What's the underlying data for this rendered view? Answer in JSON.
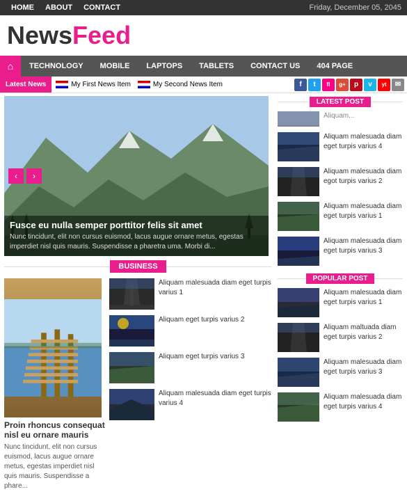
{
  "topbar": {
    "nav": [
      "HOME",
      "ABOUT",
      "CONTACT"
    ],
    "date": "Friday, December 05, 2045"
  },
  "logo": {
    "news": "News",
    "feed": "Feed"
  },
  "mainnav": {
    "home_icon": "⌂",
    "items": [
      "TECHNOLOGY",
      "MOBILE",
      "LAPTOPS",
      "TABLETS",
      "CONTACT US",
      "404 PAGE"
    ]
  },
  "ticker": {
    "label": "Latest News",
    "items": [
      {
        "text": "My First News Item"
      },
      {
        "text": "My Second News Item"
      }
    ]
  },
  "social_icons": [
    {
      "name": "facebook",
      "label": "f",
      "color": "#3b5998"
    },
    {
      "name": "twitter",
      "label": "t",
      "color": "#1da1f2"
    },
    {
      "name": "flickr",
      "label": "fl",
      "color": "#ff0084"
    },
    {
      "name": "googleplus",
      "label": "g+",
      "color": "#dd4b39"
    },
    {
      "name": "pinterest",
      "label": "p",
      "color": "#bd081c"
    },
    {
      "name": "vimeo",
      "label": "v",
      "color": "#1ab7ea"
    },
    {
      "name": "youtube",
      "label": "yt",
      "color": "#ff0000"
    },
    {
      "name": "email",
      "label": "✉",
      "color": "#888"
    }
  ],
  "slider": {
    "caption_title": "Fusce eu nulla semper porttitor felis sit amet",
    "caption_text": "Nunc tincidunt, elit non cursus euismod, lacus augue ornare metus, egestas imperdiet nisl quis mauris. Suspendisse a pharetra uma. Morbi di..."
  },
  "business": {
    "section_label": "BUSINESS",
    "main_title": "Proin rhoncus consequat nisl eu ornare mauris",
    "main_desc": "Nunc tincidunt, elit non cursus euismod, lacus augue ornare metus, egestas imperdiet nisl quis mauris. Suspendisse a phare...",
    "list": [
      {
        "text": "Aliquam malesuada diam eget turpis varius 1"
      },
      {
        "text": "Aliquam eget turpis varius 2"
      },
      {
        "text": "Aliquam eget turpis varius 3"
      },
      {
        "text": "Aliquam malesuada diam eget turpis varius 4"
      }
    ]
  },
  "latest_post": {
    "section_label": "LATEST POST",
    "items": [
      {
        "text": "Aliquam..."
      },
      {
        "text": "Aliquam malesuada diam eget turpis varius 4"
      },
      {
        "text": "Aliquam malesuada diam egot turpis varius 2"
      },
      {
        "text": "Aliquam malesuada diam eget turpis varius 1"
      },
      {
        "text": "Aliquam malesuada diam eget turpis varius 3"
      }
    ]
  },
  "popular_post": {
    "section_label": "POPULAR POST",
    "items": [
      {
        "text": "Aliquam malesuada diam eget turpis varius 1"
      },
      {
        "text": "Aliquam maltuada diam eget turpis varius 2"
      },
      {
        "text": "Aliquam malesuada diam eget turpis varius 3"
      },
      {
        "text": "Aliquam malesuada diam eget turpis varius 4"
      }
    ]
  }
}
